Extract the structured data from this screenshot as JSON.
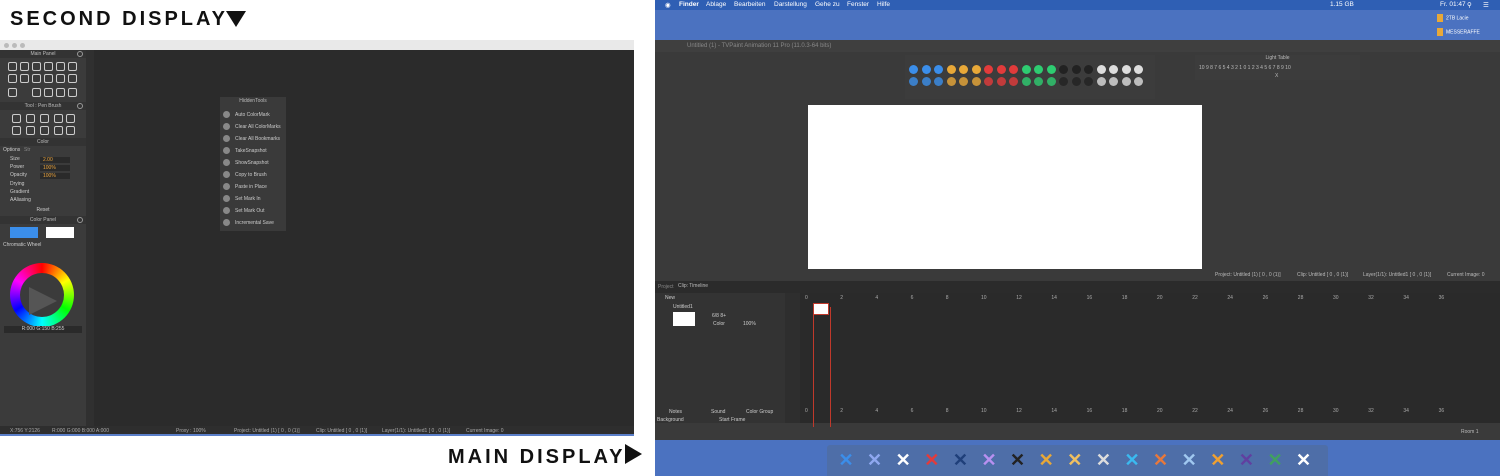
{
  "labels": {
    "second": "SECOND DISPLAY",
    "main": "MAIN DISPLAY"
  },
  "left": {
    "main_panel": "Main Panel",
    "tool_panel": "Tool : Pen Brush",
    "color_label": "Color",
    "options": "Options",
    "options_tab": "Str",
    "size_label": "Size",
    "size_val": "2.00",
    "power_label": "Power",
    "power_val": "100%",
    "opacity_label": "Opacity",
    "opacity_val": "100%",
    "drying_label": "Drying",
    "gradient_label": "Gradient",
    "aa_label": "AAliasing",
    "reset": "Reset",
    "color_panel": "Color Panel",
    "chromatic": "Chromatic Wheel",
    "rgb": "R:000 G:150 B:255",
    "main_color": "#3b8eea"
  },
  "hidden": {
    "title": "HiddenTools",
    "items": [
      "Auto ColorMark",
      "Clear All ColorMarks",
      "Clear All Bookmarks",
      "TakeSnapshot",
      "ShowSnapshot",
      "Copy to Brush",
      "Paste in Place",
      "Set Mark In",
      "Set Mark Out",
      "Incremental Save"
    ]
  },
  "sd_status": {
    "pos": "X:756 Y:2126",
    "rgba": "R:000 G:000 B:000 A:000",
    "proxy": "Proxy : 100%",
    "project": "Project: Untitled (1) [ 0 , 0 (1)]",
    "clip": "Clip: Untitled [ 0 , 0 (1)]",
    "layer": "Layer(1/1): Untitled1 [ 0 , 0 (1)]",
    "current": "Current Image: 0"
  },
  "menubar": {
    "items": [
      "Finder",
      "Ablage",
      "Bearbeiten",
      "Darstellung",
      "Gehe zu",
      "Fenster",
      "Hilfe"
    ],
    "mem": "1.15 GB",
    "clock": "Fr. 01:47"
  },
  "drives": [
    "2TB Lacie",
    "MESSERAFFE"
  ],
  "tv_title": "Untitled (1) - TVPaint Animation 11 Pro (11.0.3-64 bits)",
  "light_table": {
    "title": "Light Table",
    "nums": "10 9 8 7 6 5 4 3 2 1 0 1 2 3 4 5 6 7 8 9 10",
    "x": "X"
  },
  "info": {
    "project": "Project: Untitled (1) [ 0 , 0 (1)]",
    "clip": "Clip: Untitled [ 0 , 0 (1)]",
    "layer": "Layer(1/1): Untitled1 [ 0 , 0 (1)]",
    "current": "Current Image: 0"
  },
  "timeline": {
    "project_tab": "Project",
    "clip_tab": "Clip: Timeline",
    "new": "New",
    "layer": "Untitled1",
    "opacity": "100%",
    "color": "Color",
    "fps": "6/8 8+",
    "ticks": [
      "0",
      "2",
      "4",
      "6",
      "8",
      "10",
      "12",
      "14",
      "16",
      "18",
      "20",
      "22",
      "24",
      "26",
      "28",
      "30",
      "32",
      "34",
      "36"
    ],
    "notes": "Notes",
    "sound": "Sound",
    "color_group": "Color Group",
    "background": "Background",
    "start_frame": "Start Frame",
    "room": "Room 1"
  },
  "cm_colors": [
    "#3b8eea",
    "#3b8eea",
    "#3b8eea",
    "#e8a838",
    "#e8a838",
    "#e8a838",
    "#e23b3b",
    "#e23b3b",
    "#e23b3b",
    "#2ecc71",
    "#2ecc71",
    "#2ecc71",
    "#222",
    "#222",
    "#222",
    "#ddd",
    "#ddd",
    "#ddd",
    "#ddd"
  ],
  "dock_colors": [
    "#3b8eea",
    "#8fa8f0",
    "#ffffff",
    "#e23b3b",
    "#1f3f7a",
    "#b890f0",
    "#222222",
    "#e8a838",
    "#f0c060",
    "#dddddd",
    "#3bbaf0",
    "#e8783b",
    "#a0c8f0",
    "#f0a030",
    "#6040a0",
    "#40a060",
    "#ffffff"
  ]
}
